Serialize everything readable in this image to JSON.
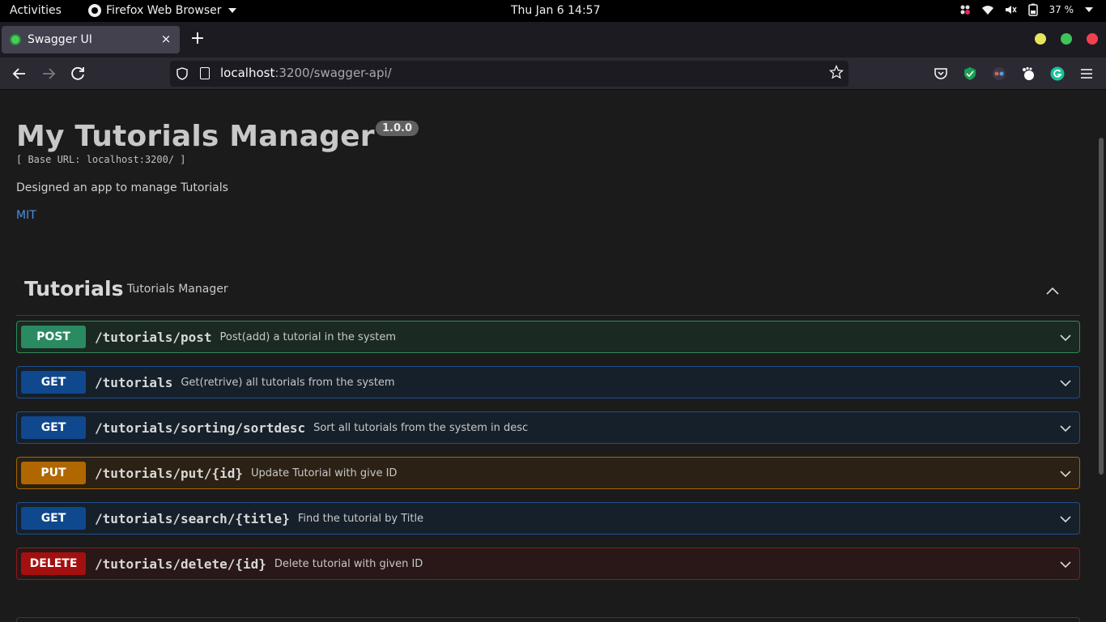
{
  "system": {
    "activities": "Activities",
    "app_name": "Firefox Web Browser",
    "clock": "Thu Jan 6  14:57",
    "battery": "37 %"
  },
  "browser": {
    "tab_title": "Swagger UI",
    "tab_close": "×",
    "new_tab": "+",
    "url_host": "localhost",
    "url_rest": ":3200/swagger-api/",
    "colors": {
      "minimize": "#e6e65c",
      "maximize": "#3ec45a",
      "close": "#f0414d"
    }
  },
  "api": {
    "title": "My Tutorials Manager",
    "version": "1.0.0",
    "base_url": "[ Base URL: localhost:3200/ ]",
    "description": "Designed an app to manage Tutorials",
    "license": "MIT"
  },
  "tag": {
    "name": "Tutorials",
    "description": "Tutorials Manager"
  },
  "operations": [
    {
      "method": "POST",
      "path": "/tutorials/post",
      "summary": "Post(add) a tutorial in the system",
      "kind": "post"
    },
    {
      "method": "GET",
      "path": "/tutorials",
      "summary": "Get(retrive) all tutorials from the system",
      "kind": "get"
    },
    {
      "method": "GET",
      "path": "/tutorials/sorting/sortdesc",
      "summary": "Sort all tutorials from the system in desc",
      "kind": "get"
    },
    {
      "method": "PUT",
      "path": "/tutorials/put/{id}",
      "summary": "Update Tutorial with give ID",
      "kind": "put"
    },
    {
      "method": "GET",
      "path": "/tutorials/search/{title}",
      "summary": "Find the tutorial by Title",
      "kind": "get"
    },
    {
      "method": "DELETE",
      "path": "/tutorials/delete/{id}",
      "summary": "Delete tutorial with given ID",
      "kind": "delete"
    }
  ]
}
